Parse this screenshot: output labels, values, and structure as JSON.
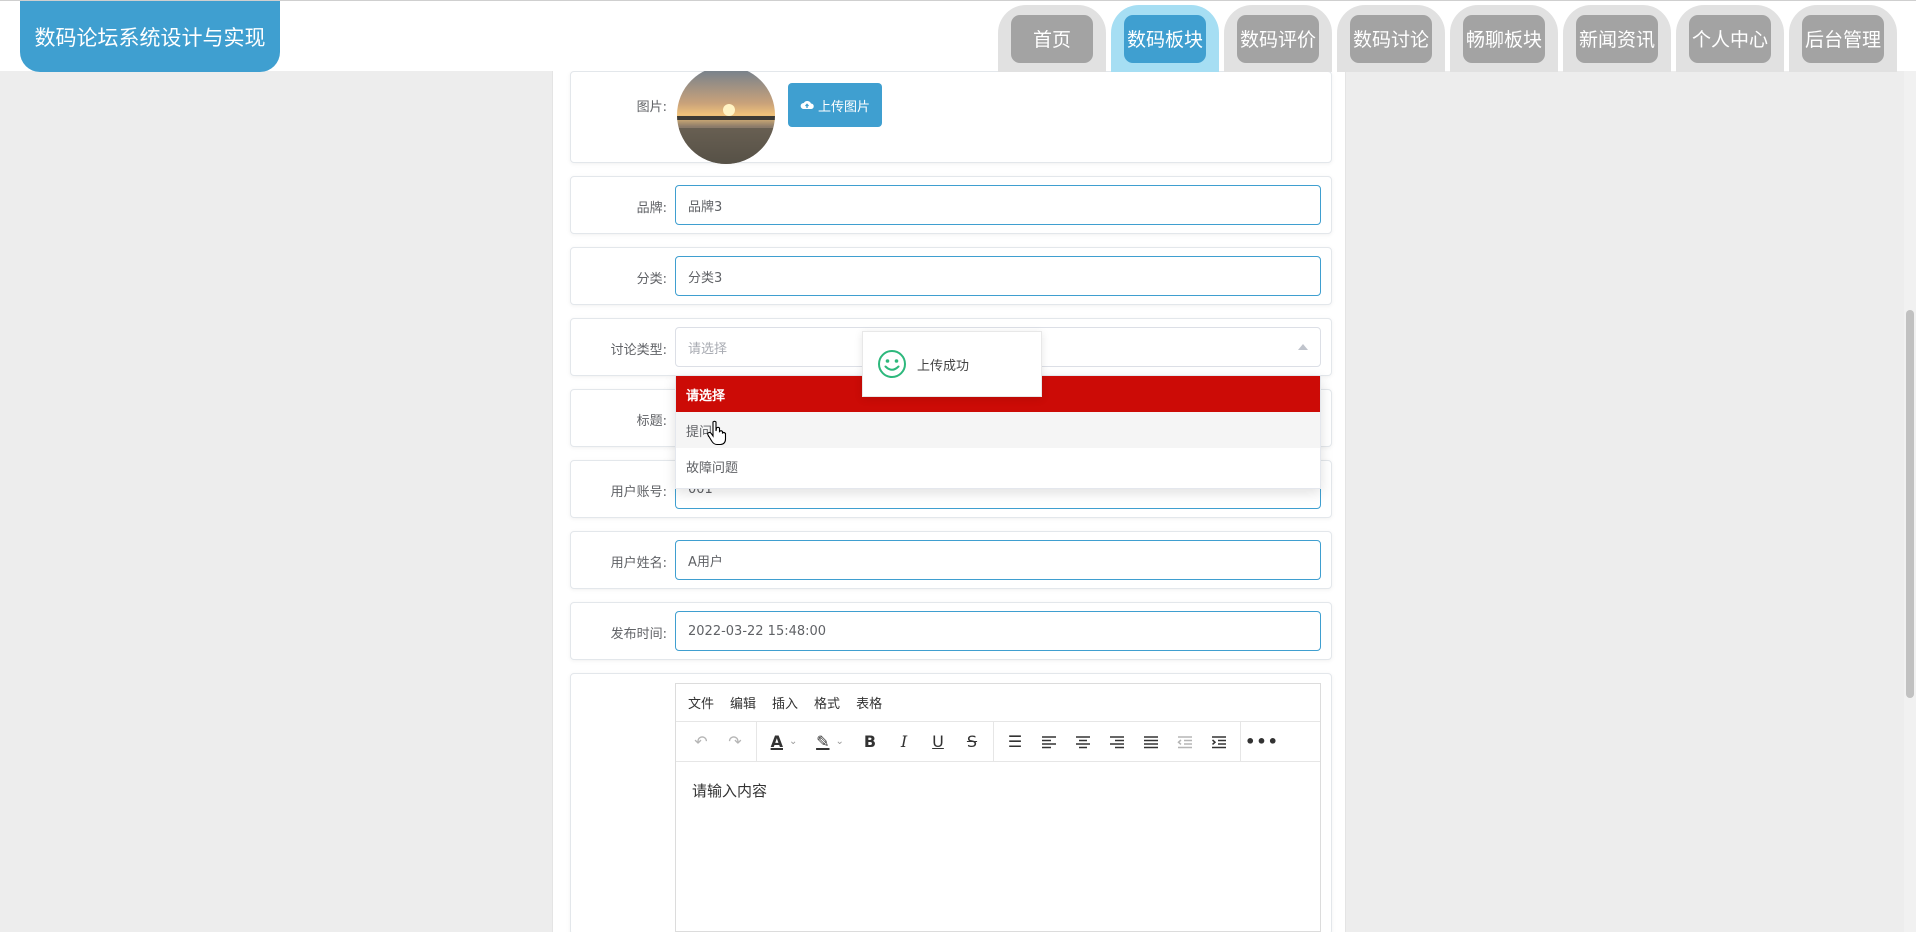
{
  "header": {
    "title": "数码论坛系统设计与实现",
    "nav": [
      {
        "label": "首页",
        "active": false
      },
      {
        "label": "数码板块",
        "active": true
      },
      {
        "label": "数码评价",
        "active": false
      },
      {
        "label": "数码讨论",
        "active": false
      },
      {
        "label": "畅聊板块",
        "active": false
      },
      {
        "label": "新闻资讯",
        "active": false
      },
      {
        "label": "个人中心",
        "active": false
      },
      {
        "label": "后台管理",
        "active": false
      }
    ]
  },
  "colors": {
    "accent": "#3f9fd0",
    "selected_option": "#cc0b06",
    "nav_inactive": "#a3a3a3"
  },
  "form": {
    "image": {
      "label": "图片:",
      "upload_label": "上传图片",
      "upload_icon": "cloud-upload-icon"
    },
    "brand": {
      "label": "品牌:",
      "value": "品牌3"
    },
    "category": {
      "label": "分类:",
      "value": "分类3"
    },
    "discussion_type": {
      "label": "讨论类型:",
      "placeholder": "请选择",
      "options": [
        "请选择",
        "提问",
        "故障问题"
      ]
    },
    "title": {
      "label": "标题:"
    },
    "user_account": {
      "label": "用户账号:",
      "value": "001"
    },
    "user_name": {
      "label": "用户姓名:",
      "value": "A用户"
    },
    "publish_time": {
      "label": "发布时间:",
      "value": "2022-03-22 15:48:00"
    }
  },
  "toast": {
    "text": "上传成功",
    "icon": "smile-icon"
  },
  "editor": {
    "menu": [
      "文件",
      "编辑",
      "插入",
      "格式",
      "表格"
    ],
    "placeholder": "请输入内容",
    "toolbar": [
      "undo-icon",
      "redo-icon",
      "font-color-icon",
      "highlight-icon",
      "bold-icon",
      "italic-icon",
      "underline-icon",
      "strikethrough-icon",
      "line-height-icon",
      "align-left-icon",
      "align-center-icon",
      "align-right-icon",
      "align-justify-icon",
      "outdent-icon",
      "indent-icon",
      "more-icon"
    ]
  }
}
